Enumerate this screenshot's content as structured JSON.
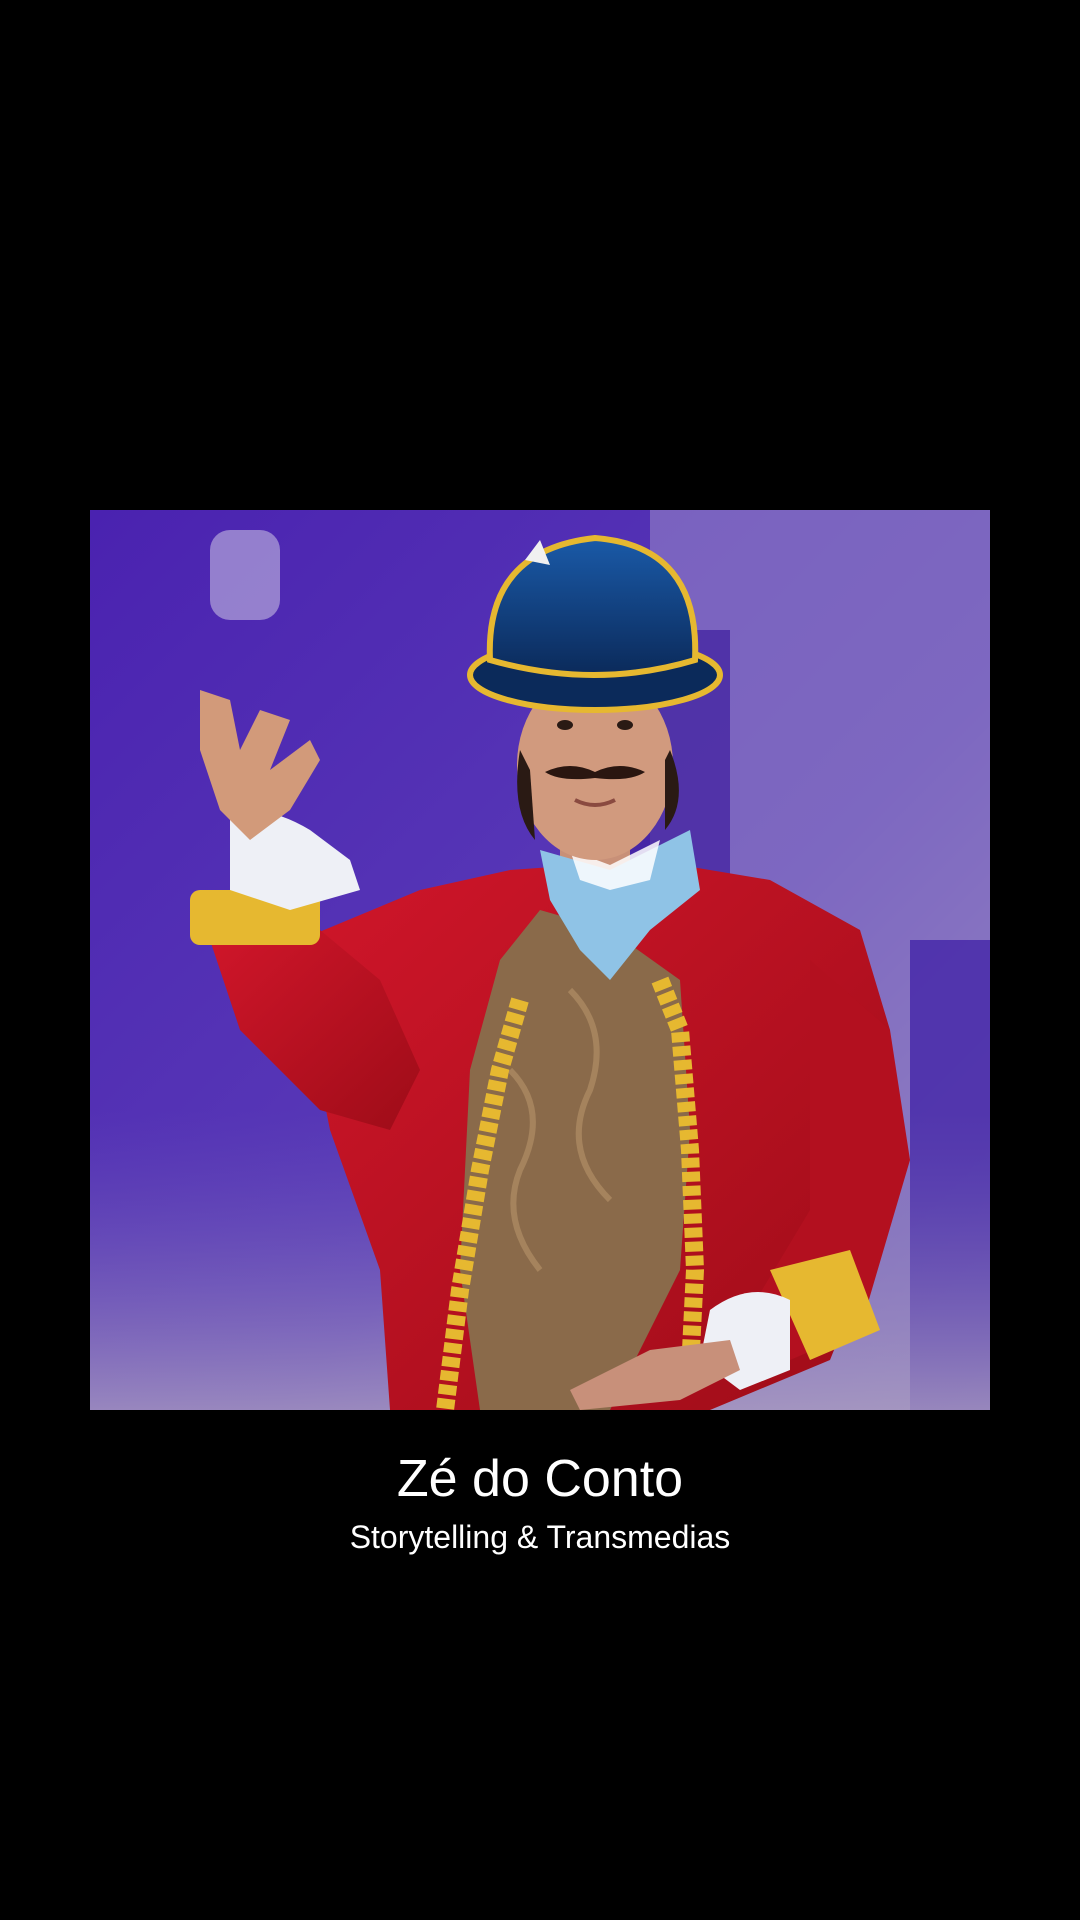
{
  "splash": {
    "title": "Zé do Conto",
    "subtitle": "Storytelling & Transmedias",
    "background_color": "#000000",
    "text_color": "#ffffff"
  },
  "photo": {
    "subject": "performer-in-costume",
    "colors": {
      "backdrop": "#4a2aa8",
      "coat": "#c0121e",
      "trim": "#e6b830",
      "hat": "#0f3a7a",
      "scarf": "#8fc3e6",
      "vest": "#8a6a4a"
    }
  }
}
